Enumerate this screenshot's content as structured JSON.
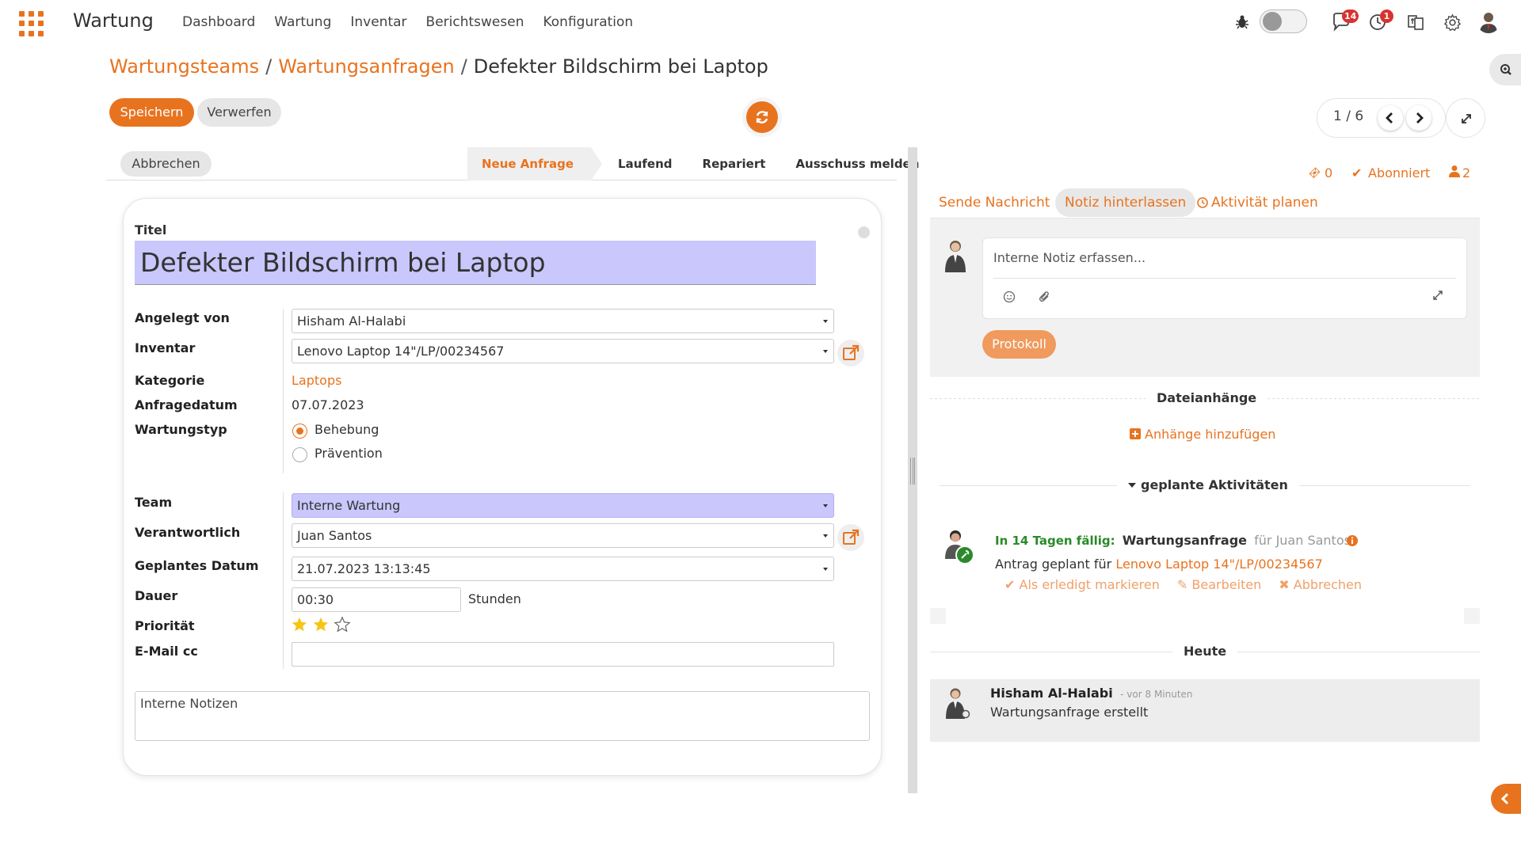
{
  "app": {
    "title": "Wartung"
  },
  "menu": [
    "Dashboard",
    "Wartung",
    "Inventar",
    "Berichtswesen",
    "Konfiguration"
  ],
  "systray": {
    "messages_count": "14",
    "activities_count": "1"
  },
  "breadcrumb": {
    "items": [
      "Wartungsteams",
      "Wartungsanfragen"
    ],
    "current": "Defekter Bildschirm bei Laptop"
  },
  "actions": {
    "save": "Speichern",
    "discard": "Verwerfen"
  },
  "pager": {
    "text": "1 / 6"
  },
  "statusbar": {
    "cancel": "Abbrechen",
    "stages": [
      {
        "label": "Neue Anfrage",
        "active": true
      },
      {
        "label": "Laufend",
        "active": false
      },
      {
        "label": "Repariert",
        "active": false
      },
      {
        "label": "Ausschuss melden",
        "active": false
      }
    ]
  },
  "form": {
    "title_label": "Titel",
    "title_value": "Defekter Bildschirm bei Laptop",
    "labels": {
      "created_by": "Angelegt von",
      "inventory": "Inventar",
      "category": "Kategorie",
      "request_date": "Anfragedatum",
      "maintenance_type": "Wartungstyp",
      "team": "Team",
      "responsible": "Verantwortlich",
      "scheduled_date": "Geplantes Datum",
      "duration": "Dauer",
      "priority": "Priorität",
      "email_cc": "E-Mail cc"
    },
    "values": {
      "created_by": "Hisham Al-Halabi",
      "inventory": "Lenovo Laptop 14\"/LP/00234567",
      "category": "Laptops",
      "request_date": "07.07.2023",
      "team": "Interne Wartung",
      "responsible": "Juan Santos",
      "scheduled_date": "21.07.2023 13:13:45",
      "duration": "00:30",
      "duration_unit": "Stunden",
      "priority_stars": 2,
      "priority_max": 3,
      "email_cc": ""
    },
    "maintenance_type_options": [
      {
        "label": "Behebung",
        "selected": true
      },
      {
        "label": "Prävention",
        "selected": false
      }
    ],
    "notes_placeholder": "Interne Notizen"
  },
  "chatter": {
    "followers": {
      "attachments": "0",
      "subscribed": "Abonniert",
      "followers": "2"
    },
    "tabs": [
      "Sende Nachricht",
      "Notiz hinterlassen",
      "Aktivität planen"
    ],
    "composer_placeholder": "Interne Notiz erfassen...",
    "log_button": "Protokoll",
    "attachments_header": "Dateianhänge",
    "add_attachments": "Anhänge hinzufügen",
    "planned_header": "geplante Aktivitäten",
    "activity": {
      "due": "In 14 Tagen fällig:",
      "title": "Wartungsanfrage",
      "for": "für Juan Santos",
      "summary_prefix": "Antrag geplant für",
      "summary_link": "Lenovo Laptop 14\"/LP/00234567",
      "mark_done": "Als erledigt markieren",
      "edit": "Bearbeiten",
      "cancel": "Abbrechen"
    },
    "today_header": "Heute",
    "message": {
      "author": "Hisham Al-Halabi",
      "time": "- vor 8 Minuten",
      "body": "Wartungsanfrage erstellt"
    }
  },
  "colors": {
    "accent": "#e8731f",
    "required_field": "#c9c7fb",
    "activity_green": "#2a8a2a"
  }
}
